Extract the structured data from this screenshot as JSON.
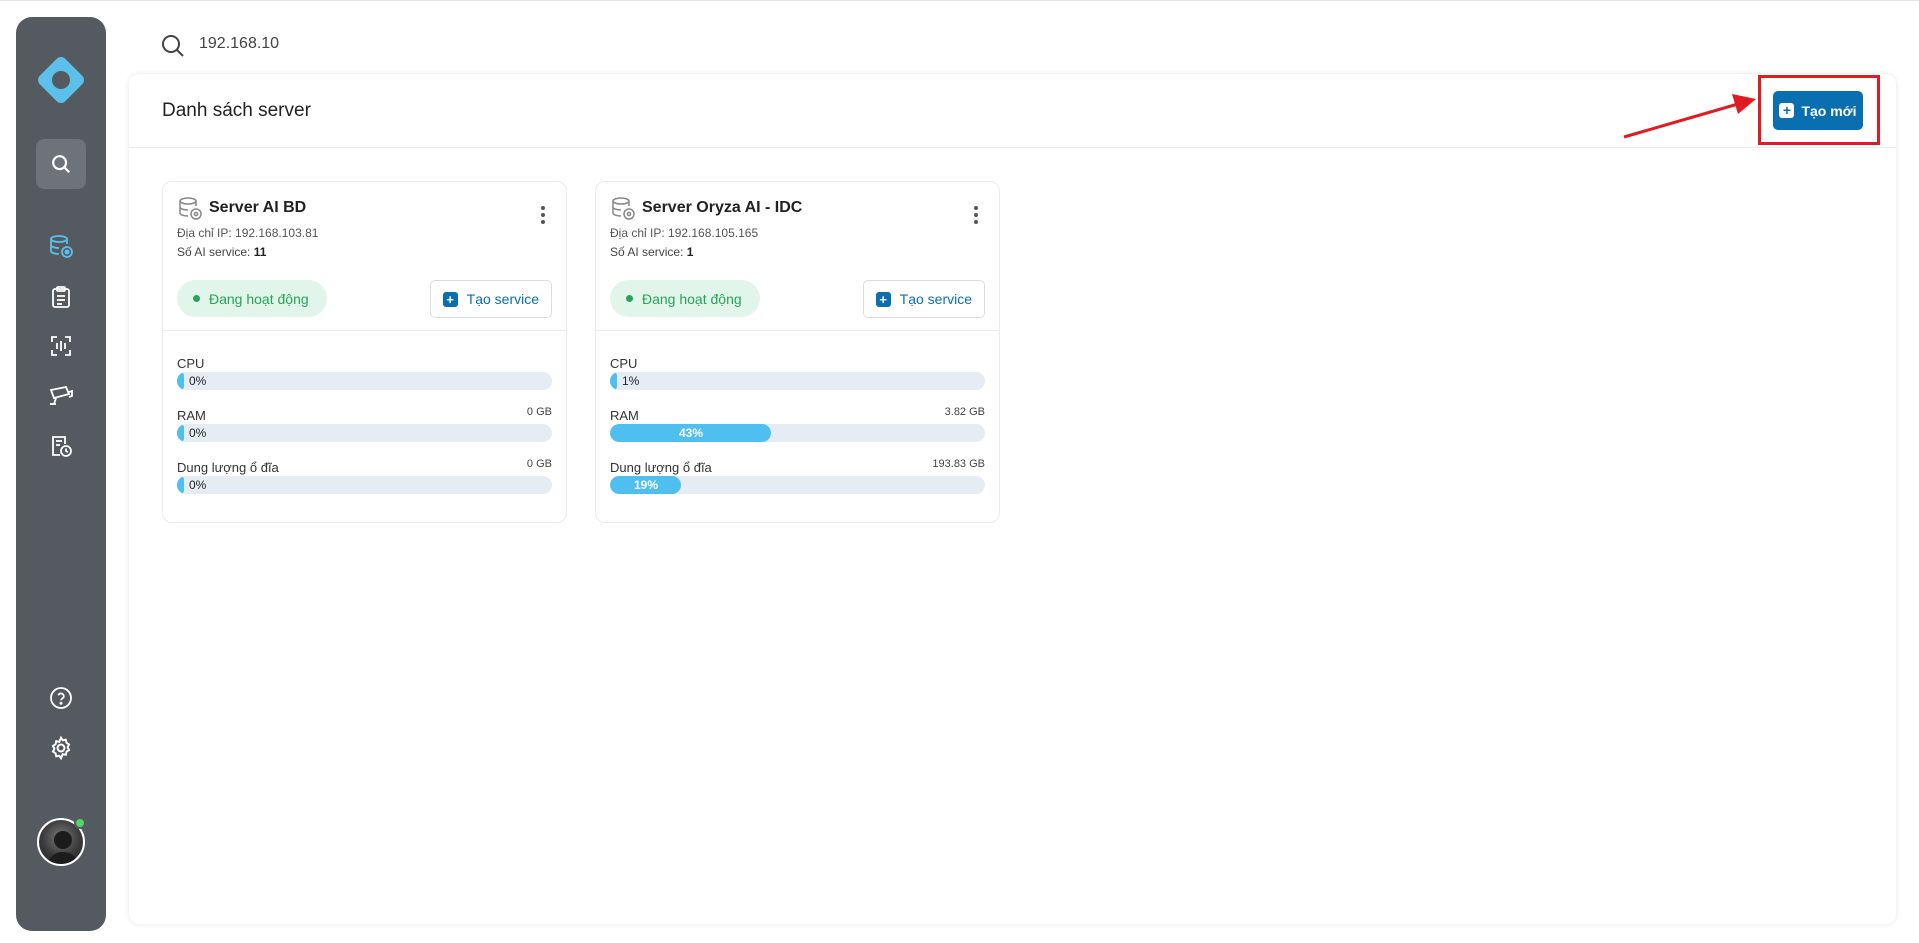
{
  "search": {
    "value": "192.168.10"
  },
  "header": {
    "title": "Danh sách server",
    "create_label": "Tạo mới"
  },
  "sidebar": {
    "items": [
      {
        "name": "search-icon"
      },
      {
        "name": "server-icon"
      },
      {
        "name": "clipboard-list-icon"
      },
      {
        "name": "scan-face-icon"
      },
      {
        "name": "camera-icon"
      },
      {
        "name": "report-clock-icon"
      },
      {
        "name": "help-icon"
      },
      {
        "name": "settings-icon"
      }
    ],
    "accent": "#5bc0ea"
  },
  "servers": [
    {
      "name": "Server AI BD",
      "ip_label": "Địa chỉ IP: ",
      "ip": "192.168.103.81",
      "svc_label": "Số AI service: ",
      "svc_count": "11",
      "status": "Đang hoạt động",
      "create_service": "Tạo service",
      "metrics": [
        {
          "label": "CPU",
          "total": "",
          "percent": 0,
          "percent_text": "0%"
        },
        {
          "label": "RAM",
          "total": "0 GB",
          "percent": 0,
          "percent_text": "0%"
        },
        {
          "label": "Dung lượng ổ đĩa",
          "total": "0 GB",
          "percent": 0,
          "percent_text": "0%"
        }
      ]
    },
    {
      "name": "Server Oryza AI - IDC",
      "ip_label": "Địa chỉ IP: ",
      "ip": "192.168.105.165",
      "svc_label": "Số AI service: ",
      "svc_count": "1",
      "status": "Đang hoạt động",
      "create_service": "Tạo service",
      "metrics": [
        {
          "label": "CPU",
          "total": "",
          "percent": 1,
          "percent_text": "1%"
        },
        {
          "label": "RAM",
          "total": "3.82 GB",
          "percent": 43,
          "percent_text": "43%"
        },
        {
          "label": "Dung lượng ổ đĩa",
          "total": "193.83 GB",
          "percent": 19,
          "percent_text": "19%"
        }
      ]
    }
  ],
  "colors": {
    "primary": "#0a6fb0",
    "status_green": "#28a35b",
    "bar": "#4fbfef",
    "highlight": "#e01b22"
  }
}
